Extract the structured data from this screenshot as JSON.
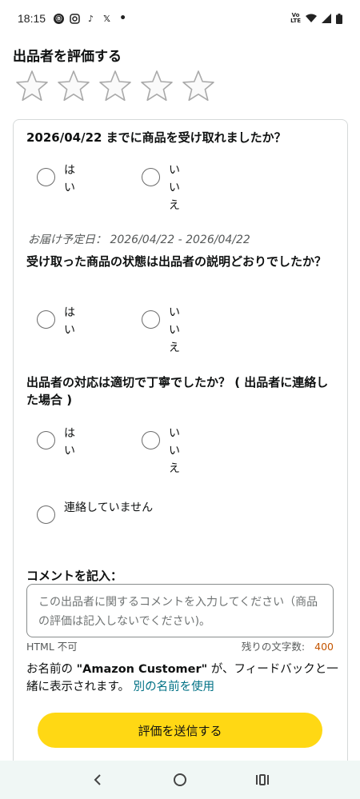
{
  "status_bar": {
    "time": "18:15",
    "icons": [
      "assistant-icon",
      "instagram-icon",
      "tiktok-icon",
      "x-icon",
      "dot-icon"
    ],
    "right_icons": [
      "volte-icon",
      "wifi-icon",
      "signal-icon",
      "battery-icon"
    ],
    "volte_top": "Vo",
    "volte_bottom": "LTE"
  },
  "page_title": "出品者を評価する",
  "rating": {
    "max": 5,
    "selected": 0
  },
  "questions": [
    {
      "text": "2026/04/22 までに商品を受け取れましたか？",
      "options": [
        "はい",
        "いいえ"
      ]
    },
    {
      "text": "受け取った商品の状態は出品者の説明どおりでしたか？",
      "options": [
        "はい",
        "いいえ"
      ]
    },
    {
      "text": "出品者の対応は適切で丁寧でしたか？ ( 出品者に連絡した場合 )",
      "options": [
        "はい",
        "いいえ",
        "連絡していません"
      ]
    }
  ],
  "delivery_note": "お届け予定日： 2026/04/22 - 2026/04/22",
  "comment": {
    "label": "コメントを記入：",
    "placeholder": "この出品者に関するコメントを入力してください（商品の評価は記入しないでください)。",
    "html_note": "HTML 不可",
    "remaining_label": "残りの文字数:",
    "remaining_count": "400"
  },
  "name_note": {
    "prefix": "お名前の ",
    "name": "\"Amazon Customer\"",
    "suffix": " が、フィードバックと一緒に表示されます。 ",
    "link": "別の名前を使用"
  },
  "submit_label": "評価を送信する",
  "colors": {
    "accent": "#ffd814",
    "link": "#007185",
    "count": "#c45500"
  }
}
